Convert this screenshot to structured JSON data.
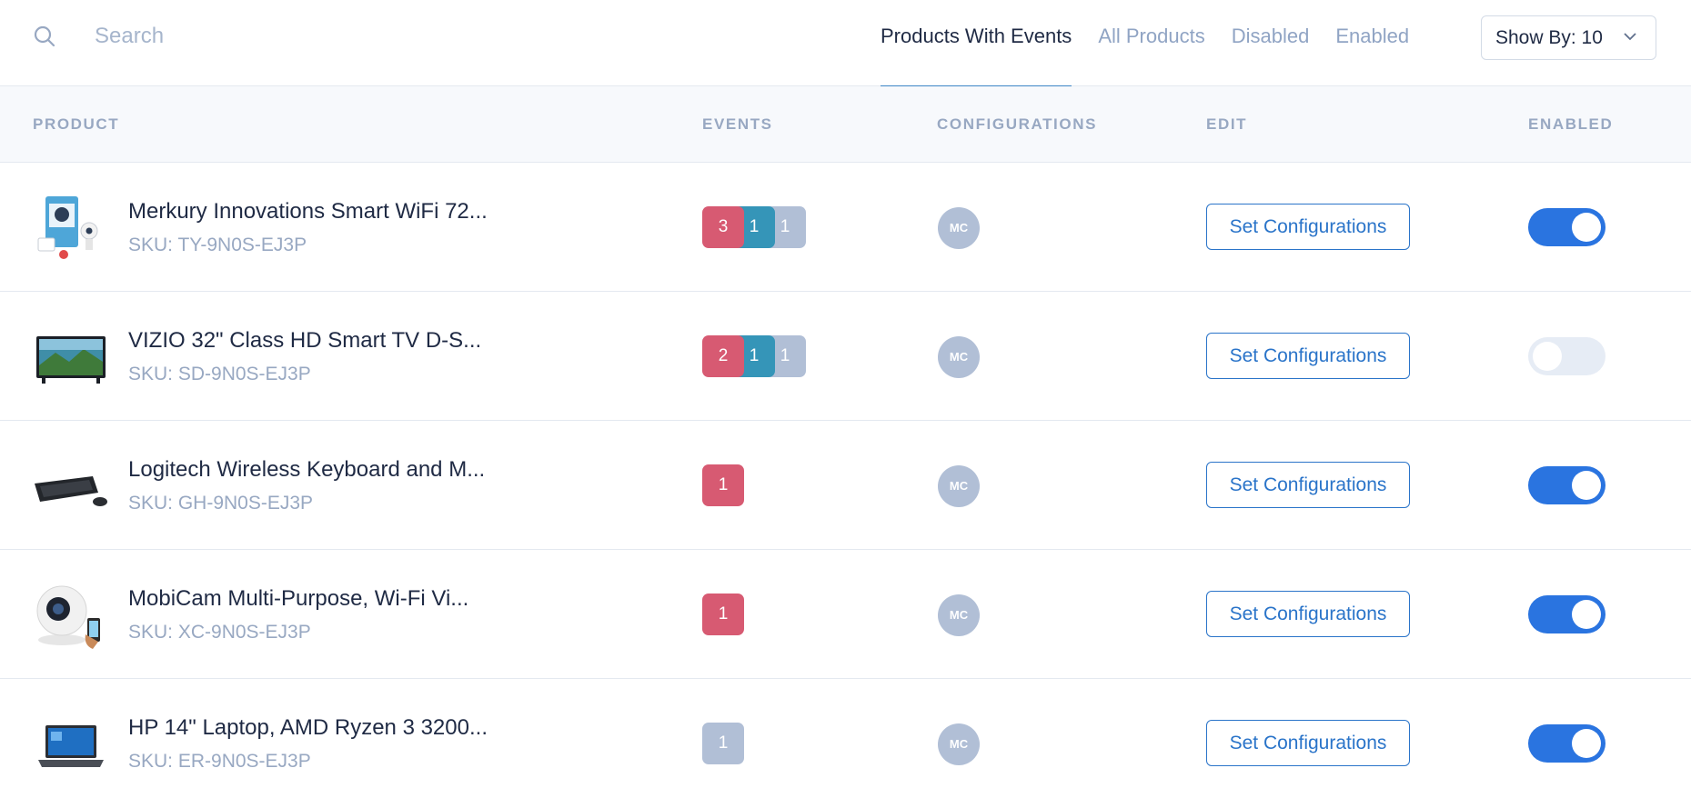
{
  "search": {
    "placeholder": "Search"
  },
  "tabs": [
    {
      "label": "Products With Events",
      "active": true
    },
    {
      "label": "All Products",
      "active": false
    },
    {
      "label": "Disabled",
      "active": false
    },
    {
      "label": "Enabled",
      "active": false
    }
  ],
  "show_by": {
    "label": "Show By: 10"
  },
  "columns": {
    "product": "PRODUCT",
    "events": "EVENTS",
    "configurations": "CONFIGURATIONS",
    "edit": "EDIT",
    "enabled": "ENABLED"
  },
  "colors": {
    "accent": "#2a74e0",
    "event_red": "#d75a72",
    "event_teal": "#3595b8",
    "event_gray": "#b1bfd6"
  },
  "rows": [
    {
      "name": "Merkury Innovations Smart WiFi 72...",
      "sku": "SKU: TY-9N0S-EJ3P",
      "image": "security-camera-box-image",
      "events": [
        {
          "count": "3",
          "color": "red"
        },
        {
          "count": "1",
          "color": "teal"
        },
        {
          "count": "1",
          "color": "gray"
        }
      ],
      "config": "MC",
      "button": "Set Configurations",
      "enabled": true
    },
    {
      "name": "VIZIO 32\" Class HD Smart TV D-S...",
      "sku": "SKU: SD-9N0S-EJ3P",
      "image": "tv-image",
      "events": [
        {
          "count": "2",
          "color": "red"
        },
        {
          "count": "1",
          "color": "teal"
        },
        {
          "count": "1",
          "color": "gray"
        }
      ],
      "config": "MC",
      "button": "Set Configurations",
      "enabled": false
    },
    {
      "name": "Logitech Wireless Keyboard and M...",
      "sku": "SKU: GH-9N0S-EJ3P",
      "image": "keyboard-image",
      "events": [
        {
          "count": "1",
          "color": "red"
        }
      ],
      "config": "MC",
      "button": "Set Configurations",
      "enabled": true
    },
    {
      "name": "MobiCam Multi-Purpose, Wi-Fi Vi...",
      "sku": "SKU: XC-9N0S-EJ3P",
      "image": "camera-image",
      "events": [
        {
          "count": "1",
          "color": "red"
        }
      ],
      "config": "MC",
      "button": "Set Configurations",
      "enabled": true
    },
    {
      "name": "HP 14\" Laptop, AMD Ryzen 3 3200...",
      "sku": "SKU: ER-9N0S-EJ3P",
      "image": "laptop-image",
      "events": [
        {
          "count": "1",
          "color": "gray"
        }
      ],
      "config": "MC",
      "button": "Set Configurations",
      "enabled": true
    }
  ]
}
